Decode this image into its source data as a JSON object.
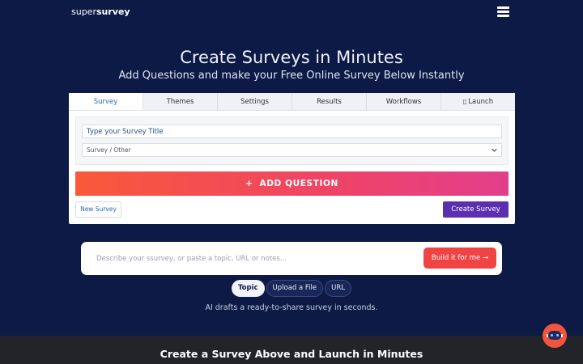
{
  "header": {
    "logo_light": "super",
    "logo_bold": "survey",
    "menu_icon": "hamburger-icon"
  },
  "hero": {
    "title": "Create Surveys in Minutes",
    "subtitle": "Add Questions and make your Free Online Survey Below Instantly"
  },
  "editor": {
    "tabs": [
      {
        "label": "Survey",
        "active": true
      },
      {
        "label": "Themes",
        "active": false
      },
      {
        "label": "Settings",
        "active": false
      },
      {
        "label": "Results",
        "active": false
      },
      {
        "label": "Workflows",
        "active": false
      },
      {
        "label": "Launch",
        "active": false,
        "icon": "rocket-icon"
      }
    ],
    "title_placeholder": "Type your Survey Title",
    "category_value": "Survey / Other",
    "add_question_label": "ADD QUESTION",
    "new_survey_label": "New Survey",
    "create_survey_label": "Create Survey"
  },
  "ai": {
    "placeholder": "Describe your ssurvey, or paste a topic, URL or notes...",
    "build_label": "Build it for me →",
    "modes": [
      {
        "label": "Topic",
        "active": true
      },
      {
        "label": "Upload a File",
        "active": false
      },
      {
        "label": "URL",
        "active": false
      }
    ],
    "note": "AI drafts a ready-to-share survey in seconds."
  },
  "footer": {
    "title": "Create a Survey Above and Launch in Minutes"
  },
  "colors": {
    "background": "#0c1a45",
    "accent_gradient_start": "#f9593a",
    "accent_gradient_end": "#e23f8c",
    "create_button": "#5b2fb0",
    "build_button": "#ef4344",
    "tab_active_text": "#2b6cb0"
  }
}
